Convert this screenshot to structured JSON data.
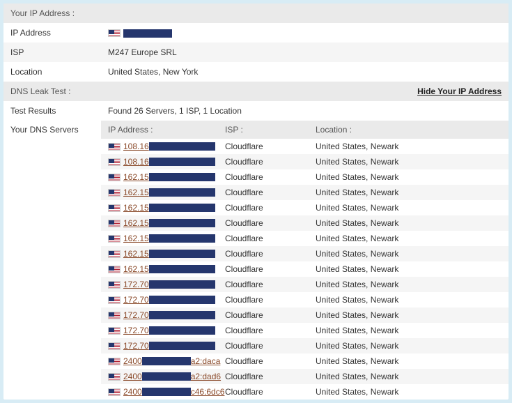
{
  "ip_section": {
    "title": "Your IP Address :",
    "rows": {
      "ip_label": "IP Address",
      "isp_label": "ISP",
      "isp_value": "M247 Europe SRL",
      "loc_label": "Location",
      "loc_value": "United States, New York"
    }
  },
  "dns_section": {
    "title": "DNS Leak Test :",
    "hide_link": "Hide Your IP Address",
    "results_label": "Test Results",
    "results_value": "Found 26 Servers, 1 ISP, 1 Location",
    "servers_label": "Your DNS Servers",
    "cols": {
      "ip": "IP Address :",
      "isp": "ISP :",
      "loc": "Location :"
    },
    "servers": [
      {
        "prefix": "108.16",
        "redact": "redact-95",
        "suffix": "",
        "isp": "Cloudflare",
        "loc": "United States, Newark"
      },
      {
        "prefix": "108.16",
        "redact": "redact-95",
        "suffix": "",
        "isp": "Cloudflare",
        "loc": "United States, Newark"
      },
      {
        "prefix": "162.15",
        "redact": "redact-95",
        "suffix": "",
        "isp": "Cloudflare",
        "loc": "United States, Newark"
      },
      {
        "prefix": "162.15",
        "redact": "redact-95",
        "suffix": "",
        "isp": "Cloudflare",
        "loc": "United States, Newark"
      },
      {
        "prefix": "162.15",
        "redact": "redact-95",
        "suffix": "",
        "isp": "Cloudflare",
        "loc": "United States, Newark"
      },
      {
        "prefix": "162.15",
        "redact": "redact-95",
        "suffix": "",
        "isp": "Cloudflare",
        "loc": "United States, Newark"
      },
      {
        "prefix": "162.15",
        "redact": "redact-95",
        "suffix": "",
        "isp": "Cloudflare",
        "loc": "United States, Newark"
      },
      {
        "prefix": "162.15",
        "redact": "redact-95",
        "suffix": "",
        "isp": "Cloudflare",
        "loc": "United States, Newark"
      },
      {
        "prefix": "162.15",
        "redact": "redact-95",
        "suffix": "",
        "isp": "Cloudflare",
        "loc": "United States, Newark"
      },
      {
        "prefix": "172.70",
        "redact": "redact-95",
        "suffix": "",
        "isp": "Cloudflare",
        "loc": "United States, Newark"
      },
      {
        "prefix": "172.70",
        "redact": "redact-95",
        "suffix": "",
        "isp": "Cloudflare",
        "loc": "United States, Newark"
      },
      {
        "prefix": "172.70",
        "redact": "redact-95",
        "suffix": "",
        "isp": "Cloudflare",
        "loc": "United States, Newark"
      },
      {
        "prefix": "172.70",
        "redact": "redact-95",
        "suffix": "",
        "isp": "Cloudflare",
        "loc": "United States, Newark"
      },
      {
        "prefix": "172.70",
        "redact": "redact-95",
        "suffix": "",
        "isp": "Cloudflare",
        "loc": "United States, Newark"
      },
      {
        "prefix": "2400",
        "redact": "redact-70",
        "suffix": "a2:daca",
        "isp": "Cloudflare",
        "loc": "United States, Newark"
      },
      {
        "prefix": "2400",
        "redact": "redact-70",
        "suffix": "a2:dad6",
        "isp": "Cloudflare",
        "loc": "United States, Newark"
      },
      {
        "prefix": "2400",
        "redact": "redact-70",
        "suffix": "c46:6dc6",
        "isp": "Cloudflare",
        "loc": "United States, Newark"
      }
    ]
  }
}
